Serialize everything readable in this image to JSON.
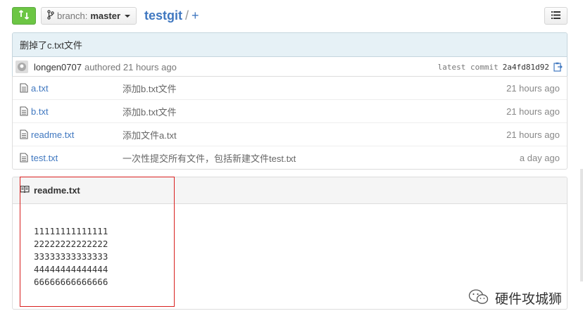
{
  "header": {
    "branch_label": "branch:",
    "branch_name": "master",
    "repo_name": "testgit",
    "separator": "/",
    "add_label": "+"
  },
  "commit": {
    "message": "删掉了c.txt文件",
    "author": "longen0707",
    "authored": "authored 21 hours ago",
    "latest_label": "latest commit",
    "sha": "2a4fd81d92"
  },
  "files": [
    {
      "name": "a.txt",
      "message": "添加b.txt文件",
      "age": "21 hours ago"
    },
    {
      "name": "b.txt",
      "message": "添加b.txt文件",
      "age": "21 hours ago"
    },
    {
      "name": "readme.txt",
      "message": "添加文件a.txt",
      "age": "21 hours ago"
    },
    {
      "name": "test.txt",
      "message": "一次性提交所有文件，包括新建文件test.txt",
      "age": "a day ago"
    }
  ],
  "readme": {
    "title": "readme.txt",
    "lines": [
      "11111111111111",
      "22222222222222",
      "33333333333333",
      "44444444444444",
      "66666666666666"
    ]
  },
  "watermark": {
    "text": "硬件攻城狮"
  },
  "colors": {
    "accent_green": "#6cc644",
    "link_blue": "#4078c0",
    "highlight_red": "#d9201f"
  }
}
